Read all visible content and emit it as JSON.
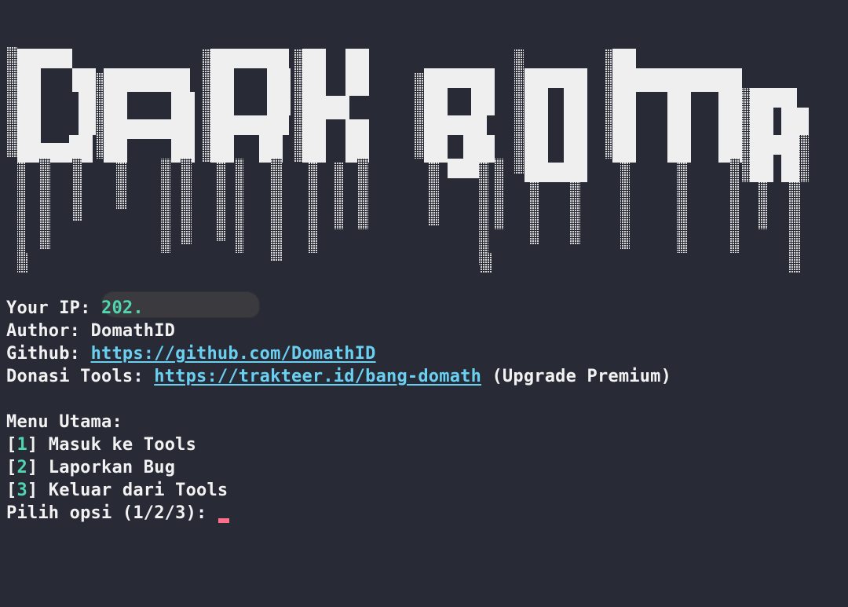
{
  "banner": {
    "text": "DARK BOMB",
    "colors": {
      "solid": "#efefef",
      "shade": "#cfcfcf",
      "background": "#282a36"
    }
  },
  "info": {
    "ip_label": "Your IP: ",
    "ip_value": "202.",
    "author_label": "Author: ",
    "author_value": "DomathID",
    "github_label": "Github: ",
    "github_url": "https://github.com/DomathID",
    "donate_label": "Donasi Tools: ",
    "donate_url": "https://trakteer.id/bang-domath",
    "donate_note": " (Upgrade Premium)"
  },
  "menu": {
    "title": "Menu Utama:",
    "options": [
      {
        "num": "1",
        "label": " Masuk ke Tools"
      },
      {
        "num": "2",
        "label": " Laporkan Bug"
      },
      {
        "num": "3",
        "label": " Keluar dari Tools"
      }
    ],
    "prompt": "Pilih opsi (1/2/3): "
  },
  "colors": {
    "background": "#282a36",
    "text": "#f2f2f2",
    "accent_green": "#4fd6b0",
    "link": "#6ad0f2",
    "cursor": "#ff6e8a"
  }
}
